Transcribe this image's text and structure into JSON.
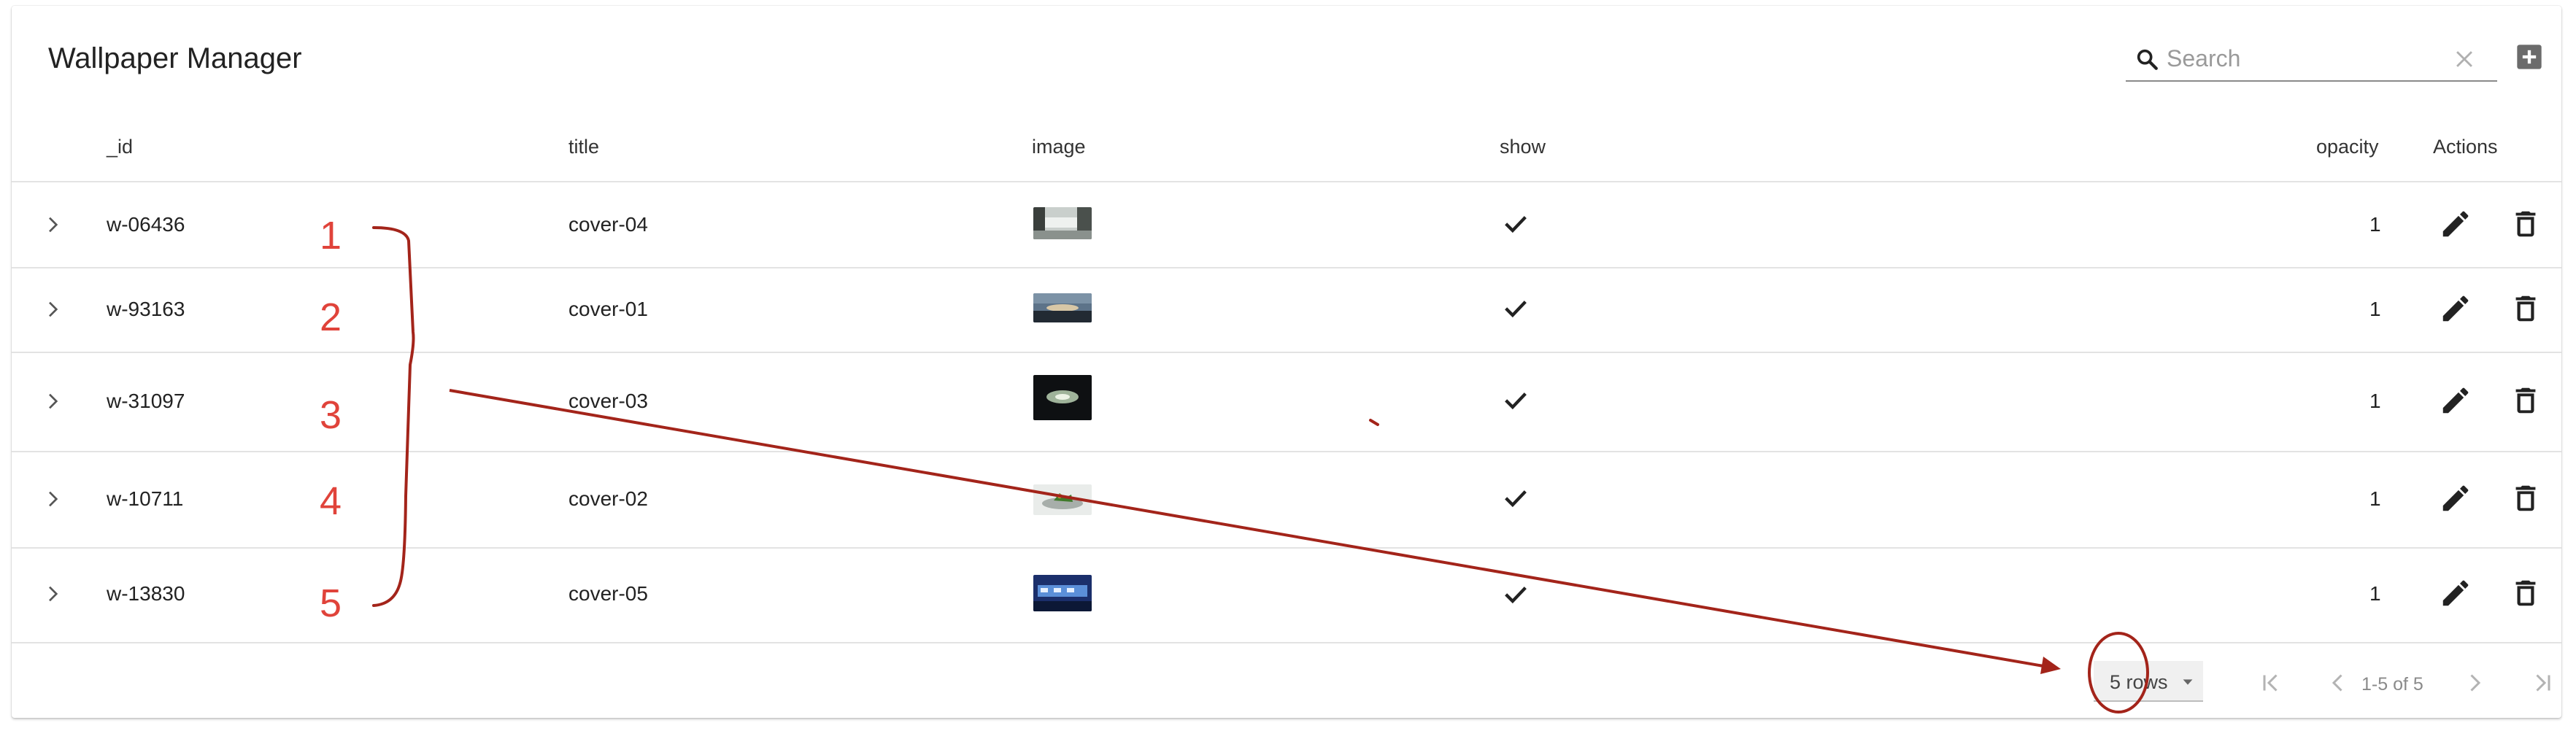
{
  "app": {
    "title": "Wallpaper Manager"
  },
  "search": {
    "placeholder": "Search",
    "value": ""
  },
  "icons": {
    "search": "search-icon",
    "clear": "close-icon",
    "add": "add-box-icon",
    "expand": "chevron-right-icon",
    "check": "check-icon",
    "edit": "pencil-icon",
    "delete": "trash-icon"
  },
  "columns": {
    "id": "_id",
    "title": "title",
    "image": "image",
    "show": "show",
    "opacity": "opacity",
    "actions": "Actions"
  },
  "rows": [
    {
      "id": "w-06436",
      "title": "cover-04",
      "show": true,
      "opacity": "1"
    },
    {
      "id": "w-93163",
      "title": "cover-01",
      "show": true,
      "opacity": "1"
    },
    {
      "id": "w-31097",
      "title": "cover-03",
      "show": true,
      "opacity": "1"
    },
    {
      "id": "w-10711",
      "title": "cover-02",
      "show": true,
      "opacity": "1"
    },
    {
      "id": "w-13830",
      "title": "cover-05",
      "show": true,
      "opacity": "1"
    }
  ],
  "pagination": {
    "rows_label": "5 rows",
    "range": "1-5 of 5"
  },
  "annotations": {
    "numbers": [
      "1",
      "2",
      "3",
      "4",
      "5"
    ],
    "color": "#e0433a",
    "arrow_color": "#a3241a"
  }
}
